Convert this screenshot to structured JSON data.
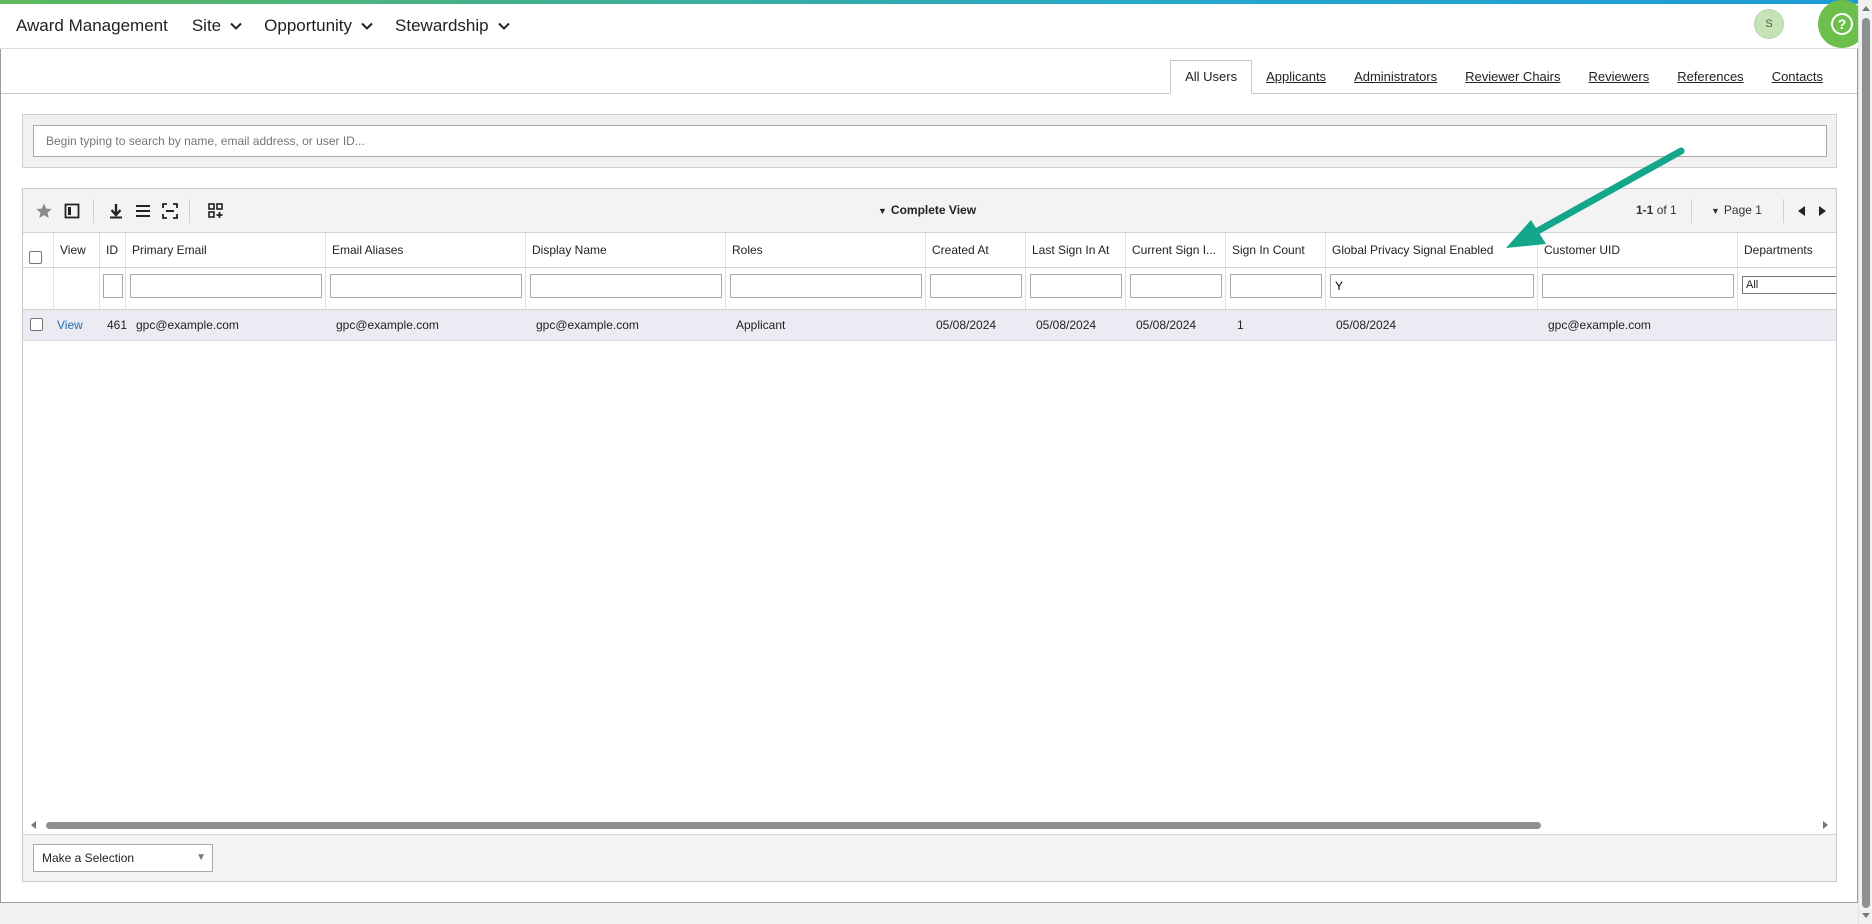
{
  "app": {
    "title": "Award Management",
    "menus": [
      "Site",
      "Opportunity",
      "Stewardship"
    ],
    "user_initial": "S",
    "help_label": "?"
  },
  "tabs": [
    {
      "label": "All Users",
      "active": true
    },
    {
      "label": "Applicants"
    },
    {
      "label": "Administrators"
    },
    {
      "label": "Reviewer Chairs"
    },
    {
      "label": "Reviewers"
    },
    {
      "label": "References"
    },
    {
      "label": "Contacts"
    }
  ],
  "search": {
    "placeholder": "Begin typing to search by name, email address, or user ID..."
  },
  "toolbar": {
    "view_label": "Complete View",
    "pager_range": "1-1",
    "pager_of": "of 1",
    "page_label": "Page 1",
    "icons": [
      "star-icon",
      "panel-icon",
      "download-icon",
      "list-icon",
      "expand-icon",
      "grid-add-icon"
    ]
  },
  "grid": {
    "columns": [
      "View",
      "ID",
      "Primary Email",
      "Email Aliases",
      "Display Name",
      "Roles",
      "Created At",
      "Last Sign In At",
      "Current Sign I...",
      "Sign In Count",
      "Global Privacy Signal Enabled",
      "Customer UID",
      "Departments"
    ],
    "filters": {
      "global_privacy": "Y",
      "departments": "All"
    },
    "rows": [
      {
        "view": "View",
        "id": "461",
        "primary_email": "gpc@example.com",
        "email_aliases": "gpc@example.com",
        "display_name": "gpc@example.com",
        "roles": "Applicant",
        "created_at": "05/08/2024",
        "last_sign_in": "05/08/2024",
        "current_sign_in": "05/08/2024",
        "sign_in_count": "1",
        "global_privacy": "05/08/2024",
        "customer_uid": "gpc@example.com",
        "departments": ""
      }
    ]
  },
  "footer": {
    "select_label": "Make a Selection"
  },
  "colors": {
    "accent_green": "#6cbf4a",
    "arrow": "#13a68a",
    "link": "#1a6fb3",
    "row_bg": "#ecebf3"
  }
}
